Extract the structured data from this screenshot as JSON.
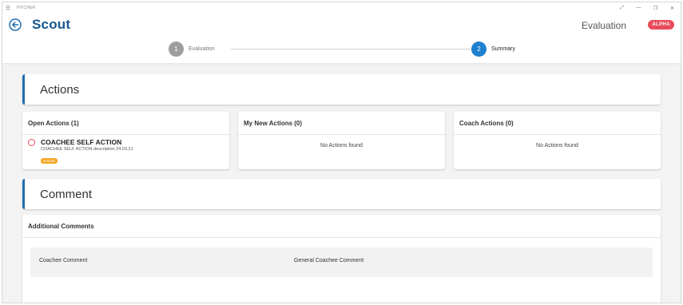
{
  "window": {
    "title": "PITCHER",
    "menu_icon": "hamburger-icon",
    "controls": {
      "fullscreen_icon": "expand-icon",
      "minimize_icon": "minimize-icon",
      "restore_icon": "restore-icon",
      "close_icon": "close-icon"
    }
  },
  "header": {
    "back_icon": "back-arrow-icon",
    "logo": "Scout",
    "title": "Evaluation",
    "badge": "ALPHA",
    "badge_color": "#e84c5a"
  },
  "stepper": {
    "steps": [
      {
        "number": "1",
        "label": "Evaluation",
        "state": "inactive",
        "color": "#9e9e9e"
      },
      {
        "number": "2",
        "label": "Summary",
        "state": "active",
        "color": "#1f80cf"
      }
    ]
  },
  "actions_section": {
    "title": "Actions",
    "accent": "#1f6fb2",
    "panels": [
      {
        "title": "Open Actions (1)",
        "items": [
          {
            "title": "COACHEE SELF ACTION",
            "description": "COACHEE SELF ACTION description 24.03.21",
            "tag": "Normal",
            "tag_color": "#f5a623",
            "status_icon": "open-circle-icon"
          }
        ]
      },
      {
        "title": "My New Actions (0)",
        "empty_text": "No Actions found"
      },
      {
        "title": "Coach Actions (0)",
        "empty_text": "No Actions found"
      }
    ]
  },
  "comment_section": {
    "title": "Comment",
    "panel_title": "Additional Comments",
    "row": {
      "label": "Coachee Comment",
      "value": "General Coachee Comment"
    }
  }
}
